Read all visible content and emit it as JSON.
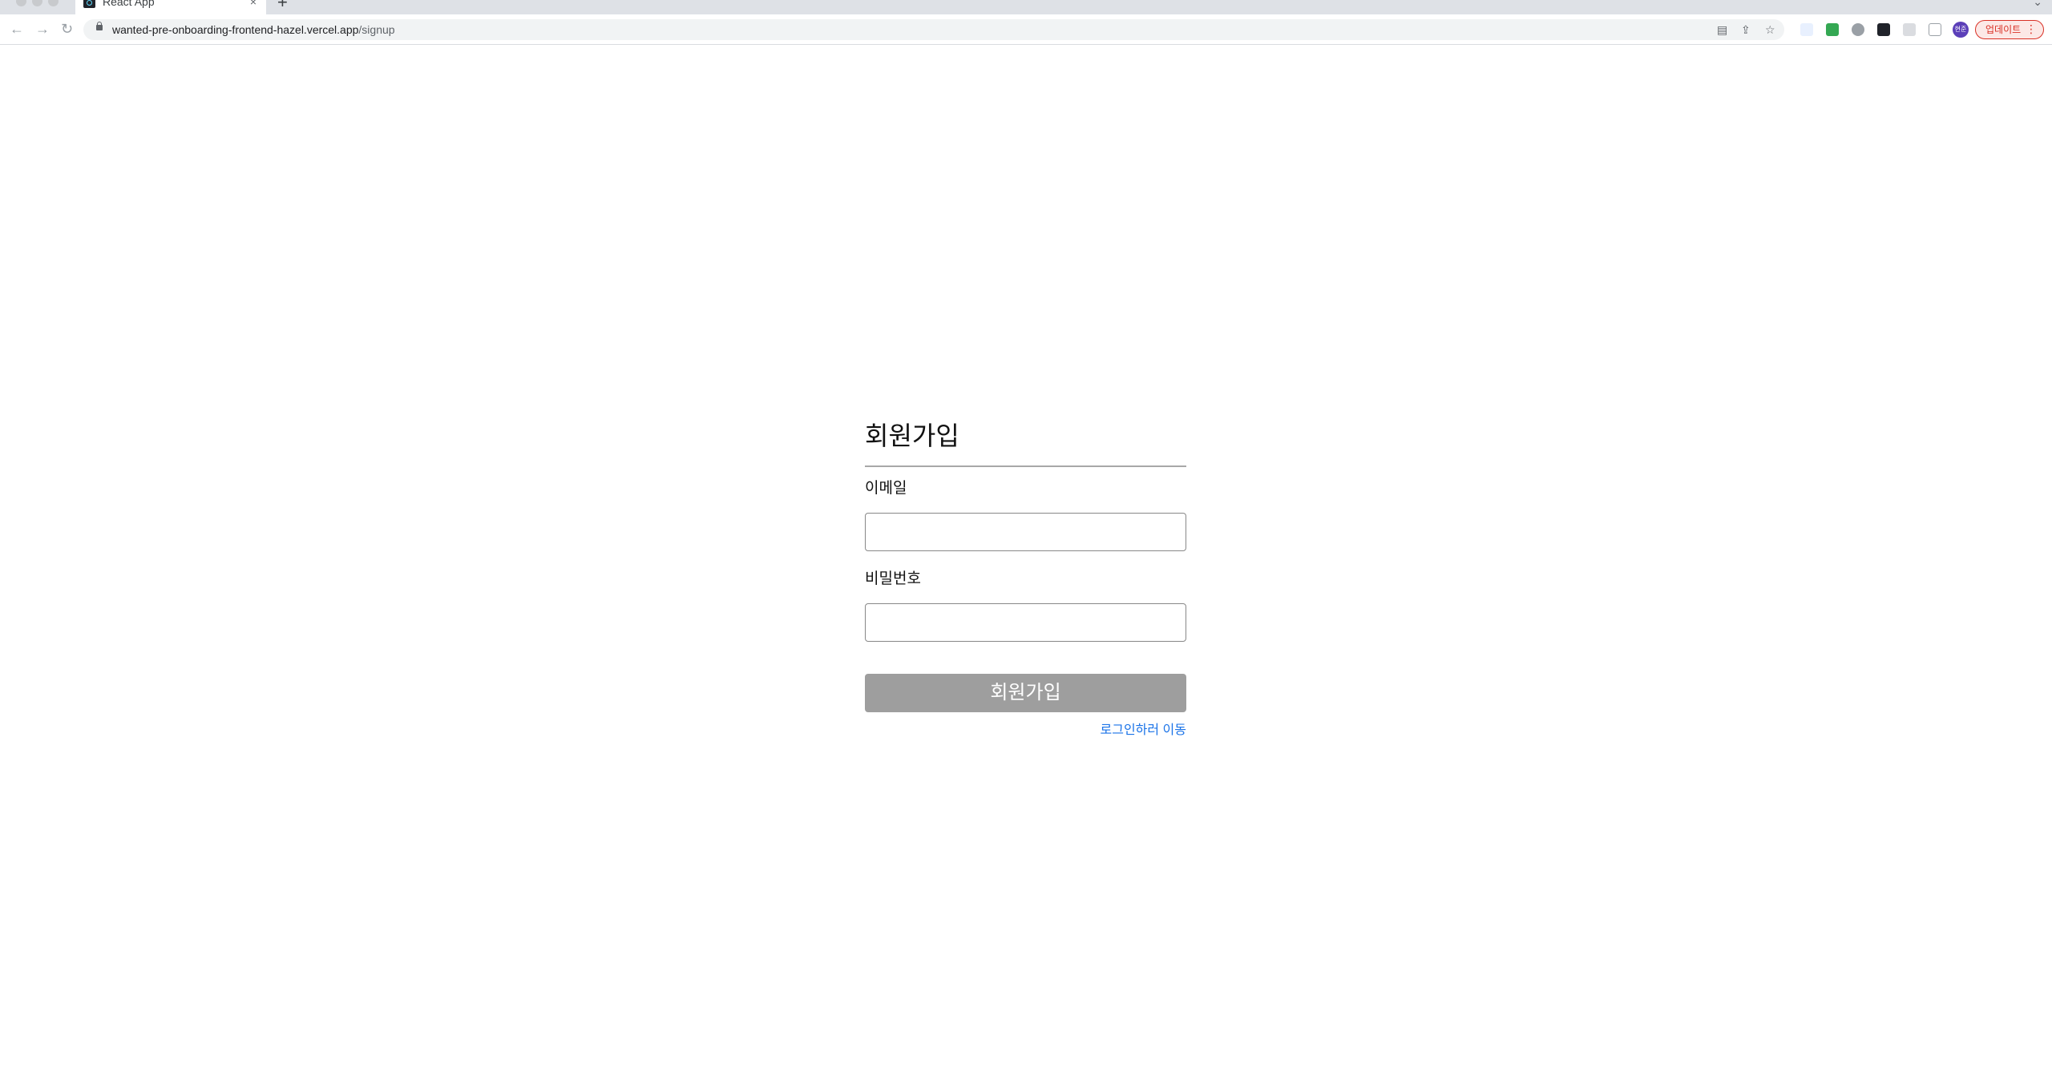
{
  "browser": {
    "tab_title": "React App",
    "tab_close": "×",
    "new_tab": "+",
    "tab_search": "⌄",
    "url_host": "wanted-pre-onboarding-frontend-hazel.vercel.app",
    "url_path": "/signup",
    "avatar_text": "현준",
    "update_label": "업데이트",
    "update_menu": "⋮",
    "icons": [
      "back-icon",
      "forward-icon",
      "reload-icon",
      "lock-icon",
      "translate-icon",
      "share-icon",
      "bookmark-star-icon",
      "extension-icons",
      "puzzle-icon",
      "sidepanel-icon"
    ]
  },
  "signup": {
    "title": "회원가입",
    "email_label": "이메일",
    "email_value": "",
    "password_label": "비밀번호",
    "password_value": "",
    "submit_label": "회원가입",
    "login_link": "로그인하러 이동"
  },
  "colors": {
    "submit_disabled": "#9e9e9e",
    "link": "#1a73e8",
    "update_accent": "#d93025"
  }
}
